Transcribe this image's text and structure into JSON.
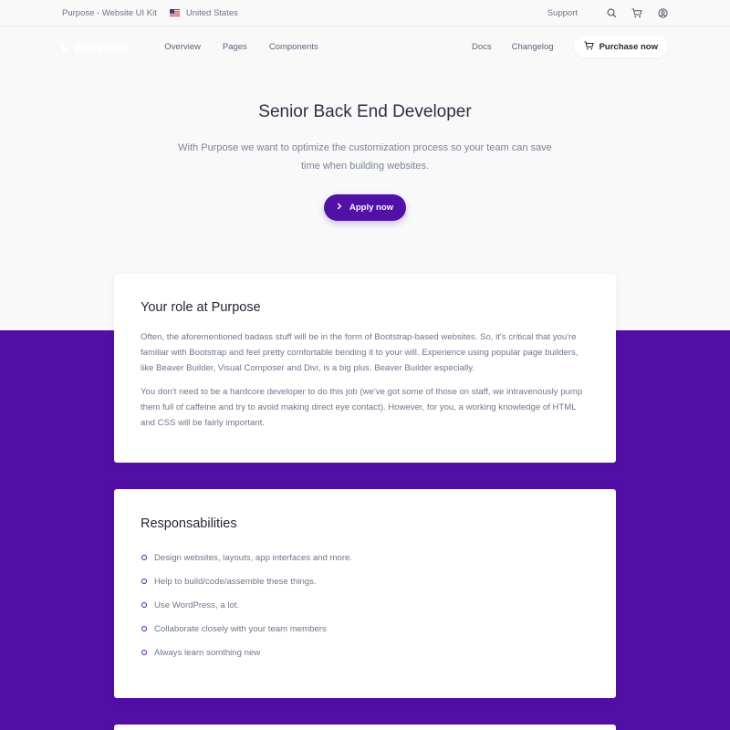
{
  "topbar": {
    "kit_label": "Purpose - Website UI Kit",
    "country": "United States",
    "support": "Support",
    "icons": [
      "search-icon",
      "cart-icon",
      "user-icon"
    ]
  },
  "nav": {
    "logo": "purpose",
    "links": [
      "Overview",
      "Pages",
      "Components"
    ],
    "right_links": [
      "Docs",
      "Changelog"
    ],
    "purchase": "Purchase now"
  },
  "hero": {
    "title": "Senior Back End Developer",
    "text": "With Purpose we want to optimize the customization process so your team can save time when building websites.",
    "apply": "Apply now"
  },
  "role": {
    "title": "Your role at Purpose",
    "paragraphs": [
      "Often, the aforementioned badass stuff will be in the form of Bootstrap-based websites. So, it's critical that you're familiar with Bootstrap and feel pretty comfortable bending it to your will. Experience using popular page builders, like Beaver Builder, Visual Composer and Divi, is a big plus. Beaver Builder especially.",
      "You don't need to be a hardcore developer to do this job (we've got some of those on staff, we intravenously pump them full of caffeine and try to avoid making direct eye contact). However, for you, a working knowledge of HTML and CSS will be fairly important."
    ]
  },
  "responsibilities": {
    "title": "Responsabilities",
    "items": [
      "Design websites, layouts, app interfaces and more.",
      "Help to build/code/assemble these things.",
      "Use WordPress, a lot.",
      "Collaborate closely with your team members",
      "Always learn somthing new"
    ]
  },
  "colors": {
    "accent": "#520fa6",
    "background": "#f9f9fa"
  }
}
